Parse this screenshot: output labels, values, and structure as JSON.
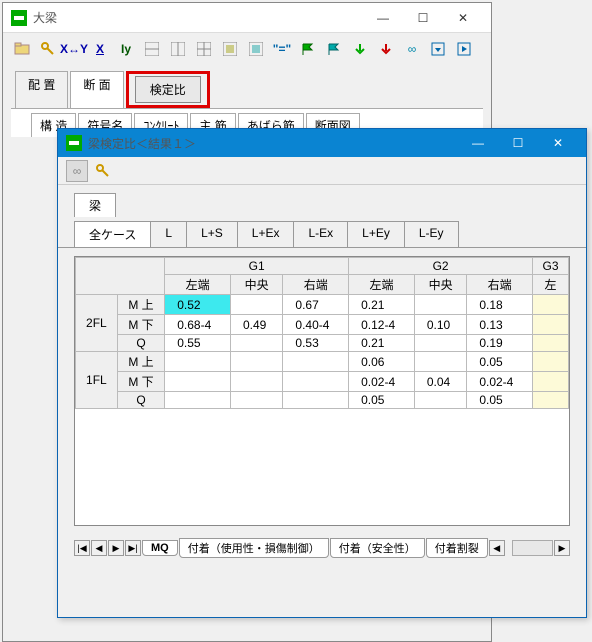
{
  "main": {
    "title": "大梁",
    "tabs": [
      "配 置",
      "断 面",
      "検定比"
    ],
    "subtabs": [
      "構 造",
      "符号名",
      "ｺﾝｸﾘｰﾄ",
      "主 筋",
      "あばら筋",
      "断面図"
    ]
  },
  "toolbar_icons": [
    "folder-icon",
    "key-icon",
    "xy-arrow-icon",
    "x-icon",
    "iy-icon",
    "grid1-icon",
    "grid2-icon",
    "grid3-icon",
    "grid4-icon",
    "grid5-icon",
    "equal-icon",
    "flag-green-icon",
    "flag-teal-icon",
    "down-green-icon",
    "down-red-icon",
    "link-icon",
    "panel-down-icon",
    "panel-right-icon"
  ],
  "sub": {
    "title": "梁検定比＜結果１＞",
    "small_tab": "梁",
    "case_tabs": [
      "全ケース",
      "L",
      "L+S",
      "L+Ex",
      "L-Ex",
      "L+Ey",
      "L-Ey"
    ],
    "bottom_tabs": [
      "MQ",
      "付着（使用性・損傷制御）",
      "付着（安全性）",
      "付着割裂"
    ]
  },
  "table": {
    "top_headers": [
      "G1",
      "G2",
      "G3"
    ],
    "sub_headers": [
      "左端",
      "中央",
      "右端",
      "左端",
      "中央",
      "右端",
      "左"
    ],
    "floors": [
      "2FL",
      "1FL"
    ],
    "row_types": [
      "M 上",
      "M 下",
      "Q"
    ],
    "data": {
      "2FL": {
        "M 上": [
          "0.52",
          "",
          "0.67",
          "0.21",
          "",
          "0.18",
          ""
        ],
        "M 下": [
          "0.68-4",
          "0.49",
          "0.40-4",
          "0.12-4",
          "0.10",
          "0.13",
          ""
        ],
        "Q": [
          "0.55",
          "",
          "0.53",
          "0.21",
          "",
          "0.19",
          ""
        ]
      },
      "1FL": {
        "M 上": [
          "",
          "",
          "",
          "0.06",
          "",
          "0.05",
          ""
        ],
        "M 下": [
          "",
          "",
          "",
          "0.02-4",
          "0.04",
          "0.02-4",
          ""
        ],
        "Q": [
          "",
          "",
          "",
          "0.05",
          "",
          "0.05",
          ""
        ]
      }
    },
    "highlight": {
      "floor": "2FL",
      "row": "M 上",
      "col": 0
    }
  }
}
